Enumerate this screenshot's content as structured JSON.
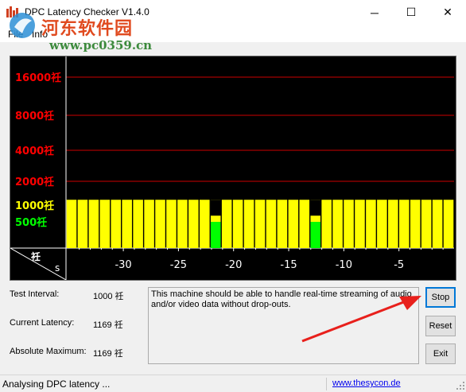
{
  "window": {
    "title": "DPC Latency Checker V1.4.0",
    "minimize_glyph": "─",
    "maximize_glyph": "☐",
    "close_glyph": "✕"
  },
  "menu": [
    "File",
    "Info"
  ],
  "watermark": {
    "title": "河东软件园",
    "url": "www.pc0359.cn"
  },
  "chart_data": {
    "type": "bar",
    "y_ticks": [
      {
        "label": "16000",
        "unit": "祍",
        "value": 16000,
        "color": "#ff0000",
        "gridline": true
      },
      {
        "label": "8000",
        "unit": "祍",
        "value": 8000,
        "color": "#ff0000",
        "gridline": true
      },
      {
        "label": "4000",
        "unit": "祍",
        "value": 4000,
        "color": "#ff0000",
        "gridline": true
      },
      {
        "label": "2000",
        "unit": "祍",
        "value": 2000,
        "color": "#ff0000",
        "gridline": true
      },
      {
        "label": "1000",
        "unit": "祍",
        "value": 1000,
        "color": "#ffff00",
        "gridline": false
      },
      {
        "label": "500",
        "unit": "祍",
        "value": 500,
        "color": "#00ff00",
        "gridline": false
      }
    ],
    "corner_labels": {
      "unit": "祍",
      "x_unit": "s"
    },
    "x_tick_labels": [
      "-30",
      "-25",
      "-20",
      "-15",
      "-10",
      "-5"
    ],
    "x_tick_values": [
      -30,
      -25,
      -20,
      -15,
      -10,
      -5
    ],
    "bar_values_us": [
      1169,
      1169,
      1169,
      1169,
      1169,
      1169,
      1169,
      1169,
      1169,
      1169,
      1169,
      1169,
      1169,
      1169,
      1169,
      1169,
      1169,
      1169,
      1169,
      1169,
      1169,
      1169,
      1169,
      1169,
      1169,
      1169,
      1169,
      1169,
      1169,
      1169,
      1169,
      1169,
      1169,
      1169,
      1169
    ],
    "green_segment_indices": [
      13,
      22
    ],
    "colors": {
      "bar": "#ffff00",
      "ok": "#00ff00",
      "grid": "#cc0000"
    }
  },
  "info": {
    "test_interval_label": "Test Interval:",
    "test_interval_value": "1000 祍",
    "current_latency_label": "Current Latency:",
    "current_latency_value": "1169 祍",
    "absolute_max_label": "Absolute Maximum:",
    "absolute_max_value": "1169 祍"
  },
  "message": "This machine should be able to handle real-time streaming of audio and/or video data without drop-outs.",
  "buttons": {
    "stop": "Stop",
    "reset": "Reset",
    "exit": "Exit"
  },
  "status": {
    "text": "Analysing DPC latency ...",
    "link": "www.thesycon.de"
  },
  "accent_colors": {
    "arrow": "#e8201c",
    "link": "#0000ee",
    "focus": "#0078d7"
  }
}
